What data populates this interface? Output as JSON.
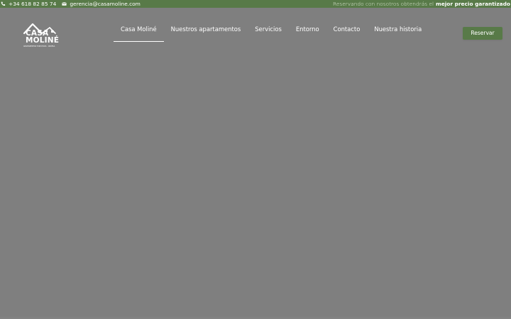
{
  "topbar": {
    "phone": "+34 618 82 85 74",
    "email": "gerencia@casamoline.com",
    "promo_light": "Reservando con nosotros obtendrás el",
    "promo_strong": "mejor precio garantizado",
    "background_color": "#587a48"
  },
  "logo": {
    "line1": "CASA",
    "line2": "MOLINÉ",
    "tagline": "APARTAMENTOS TURISTICOS · ORDESA"
  },
  "nav": {
    "items": [
      {
        "label": "Casa Moliné",
        "active": true
      },
      {
        "label": "Nuestros apartamentos",
        "active": false
      },
      {
        "label": "Servicios",
        "active": false
      },
      {
        "label": "Entorno",
        "active": false
      },
      {
        "label": "Contacto",
        "active": false
      },
      {
        "label": "Nuestra historia",
        "active": false
      }
    ]
  },
  "header": {
    "reserve_label": "Reservar",
    "accent_color": "#587a48"
  },
  "icons": {
    "phone": "phone-icon",
    "email": "envelope-icon",
    "logo": "house-roof-icon"
  },
  "hero": {
    "background_color": "#7f7f7f"
  }
}
